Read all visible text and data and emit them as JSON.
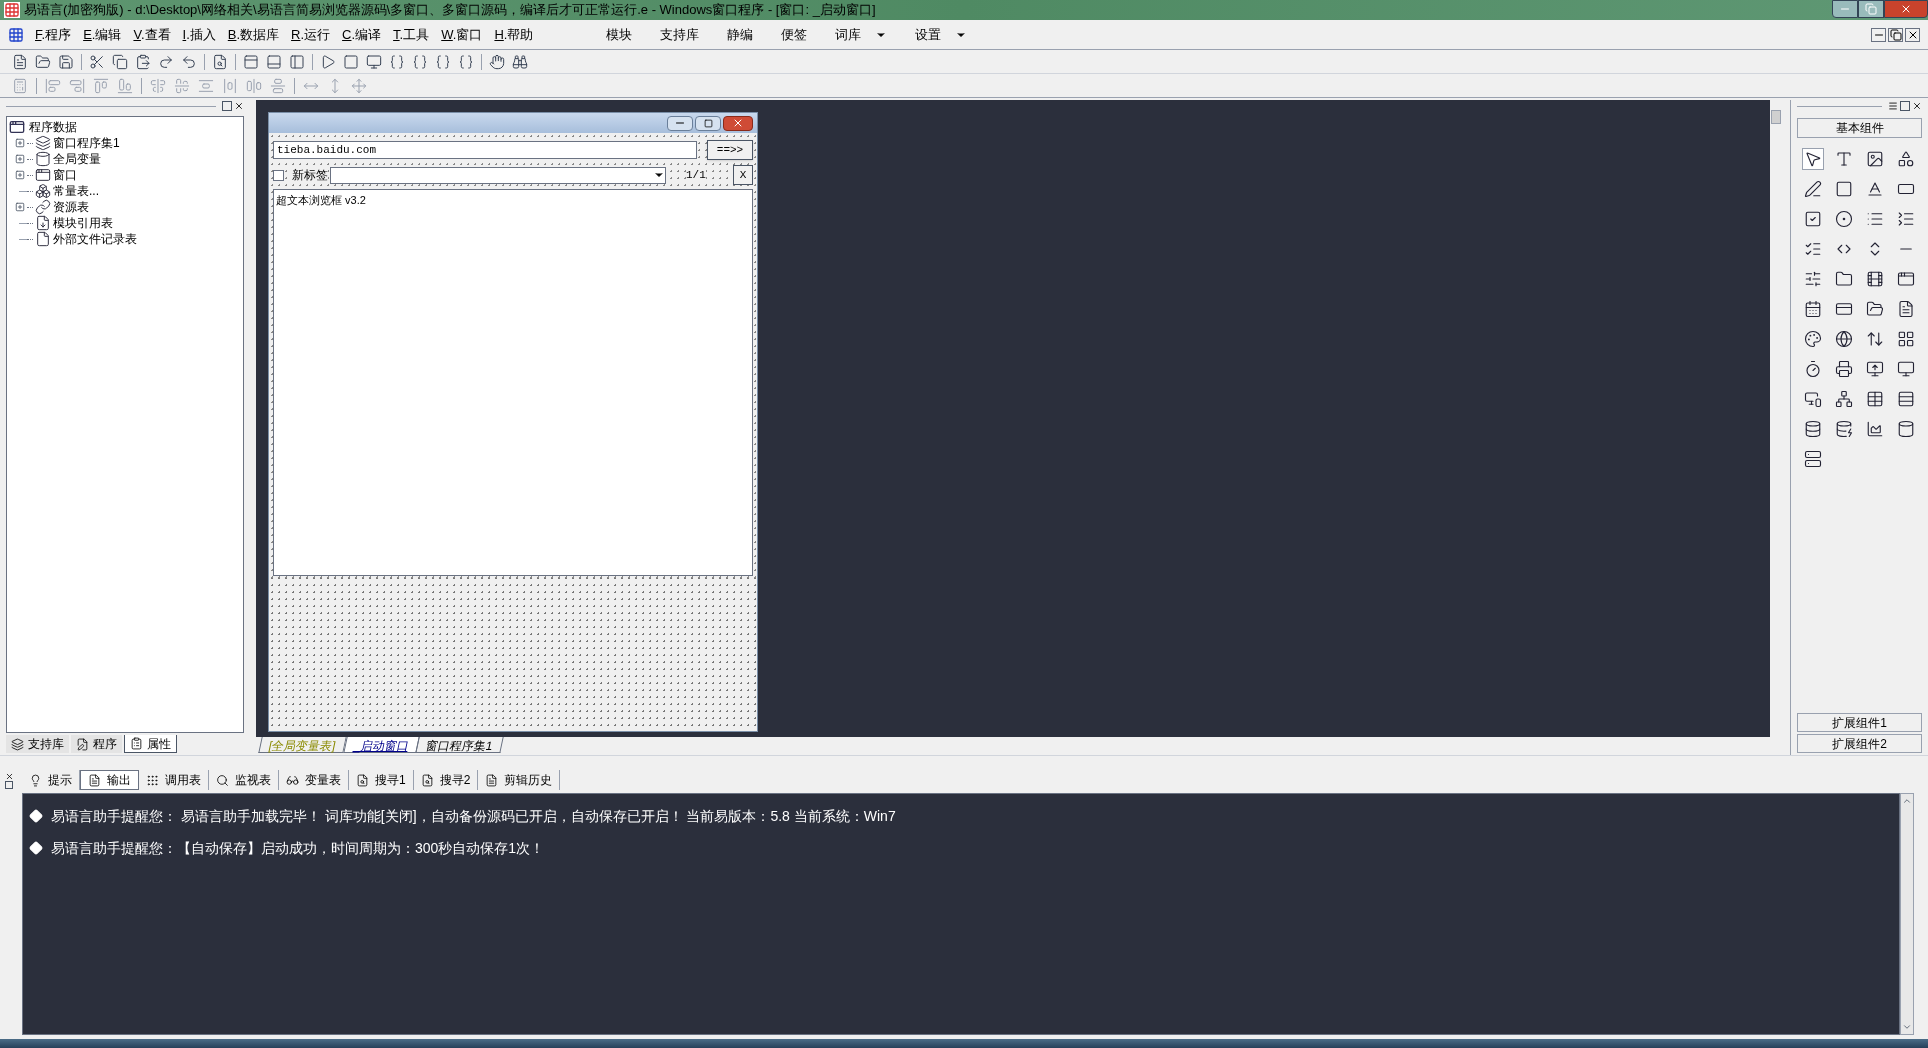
{
  "window": {
    "title": "易语言(加密狗版) - d:\\Desktop\\网络相关\\易语言简易浏览器源码\\多窗口、多窗口源码，编译后才可正常运行.e - Windows窗口程序 - [窗口: _启动窗口]"
  },
  "menu": [
    {
      "label": "F.程序"
    },
    {
      "label": "E.编辑"
    },
    {
      "label": "V.查看"
    },
    {
      "label": "I.插入"
    },
    {
      "label": "B.数据库"
    },
    {
      "label": "R.运行"
    },
    {
      "label": "C.编译"
    },
    {
      "label": "T.工具"
    },
    {
      "label": "W.窗口"
    },
    {
      "label": "H.帮助"
    }
  ],
  "extra_menu": [
    {
      "label": "模块",
      "dropdown": false
    },
    {
      "label": "支持库",
      "dropdown": false
    },
    {
      "label": "静编",
      "dropdown": false
    },
    {
      "label": "便签",
      "dropdown": false
    },
    {
      "label": "词库",
      "dropdown": true
    },
    {
      "label": "设置",
      "dropdown": true
    }
  ],
  "tree": {
    "root": "程序数据",
    "children": [
      {
        "label": "窗口程序集1",
        "kind": "collapsed"
      },
      {
        "label": "全局变量",
        "kind": "collapsed"
      },
      {
        "label": "窗口",
        "kind": "collapsed"
      },
      {
        "label": "常量表...",
        "kind": "leaf"
      },
      {
        "label": "资源表",
        "kind": "collapsed"
      },
      {
        "label": "模块引用表",
        "kind": "leaf"
      },
      {
        "label": "外部文件记录表",
        "kind": "leaf"
      }
    ]
  },
  "left_tabs": [
    {
      "label": "支持库",
      "selected": false
    },
    {
      "label": "程序",
      "selected": false
    },
    {
      "label": "属性",
      "selected": true
    }
  ],
  "form": {
    "url": "tieba.baidu.com",
    "go_button": "==>>",
    "new_tab": {
      "label": "新标签",
      "checked": false
    },
    "page": "1/1",
    "close_button": "X",
    "browser_text": "超文本浏览框 v3.2"
  },
  "editor_tabs": [
    {
      "label": "[全局变量表]",
      "selected": false
    },
    {
      "label": "_启动窗口",
      "selected": true
    },
    {
      "label": "窗口程序集1",
      "selected": false
    }
  ],
  "palette": {
    "title": "基本组件",
    "extensions": [
      "扩展组件1",
      "扩展组件2"
    ]
  },
  "output_tabs": [
    {
      "label": "提示",
      "selected": false
    },
    {
      "label": "输出",
      "selected": true
    },
    {
      "label": "调用表",
      "selected": false
    },
    {
      "label": "监视表",
      "selected": false
    },
    {
      "label": "变量表",
      "selected": false
    },
    {
      "label": "搜寻1",
      "selected": false
    },
    {
      "label": "搜寻2",
      "selected": false
    },
    {
      "label": "剪辑历史",
      "selected": false
    }
  ],
  "messages": [
    "易语言助手提醒您：  易语言助手加载完毕！  词库功能[关闭]，自动备份源码已开启，自动保存已开启！  当前易版本：5.8  当前系统：Win7",
    "易语言助手提醒您：【自动保存】启动成功，时间周期为：300秒自动保存1次！"
  ]
}
